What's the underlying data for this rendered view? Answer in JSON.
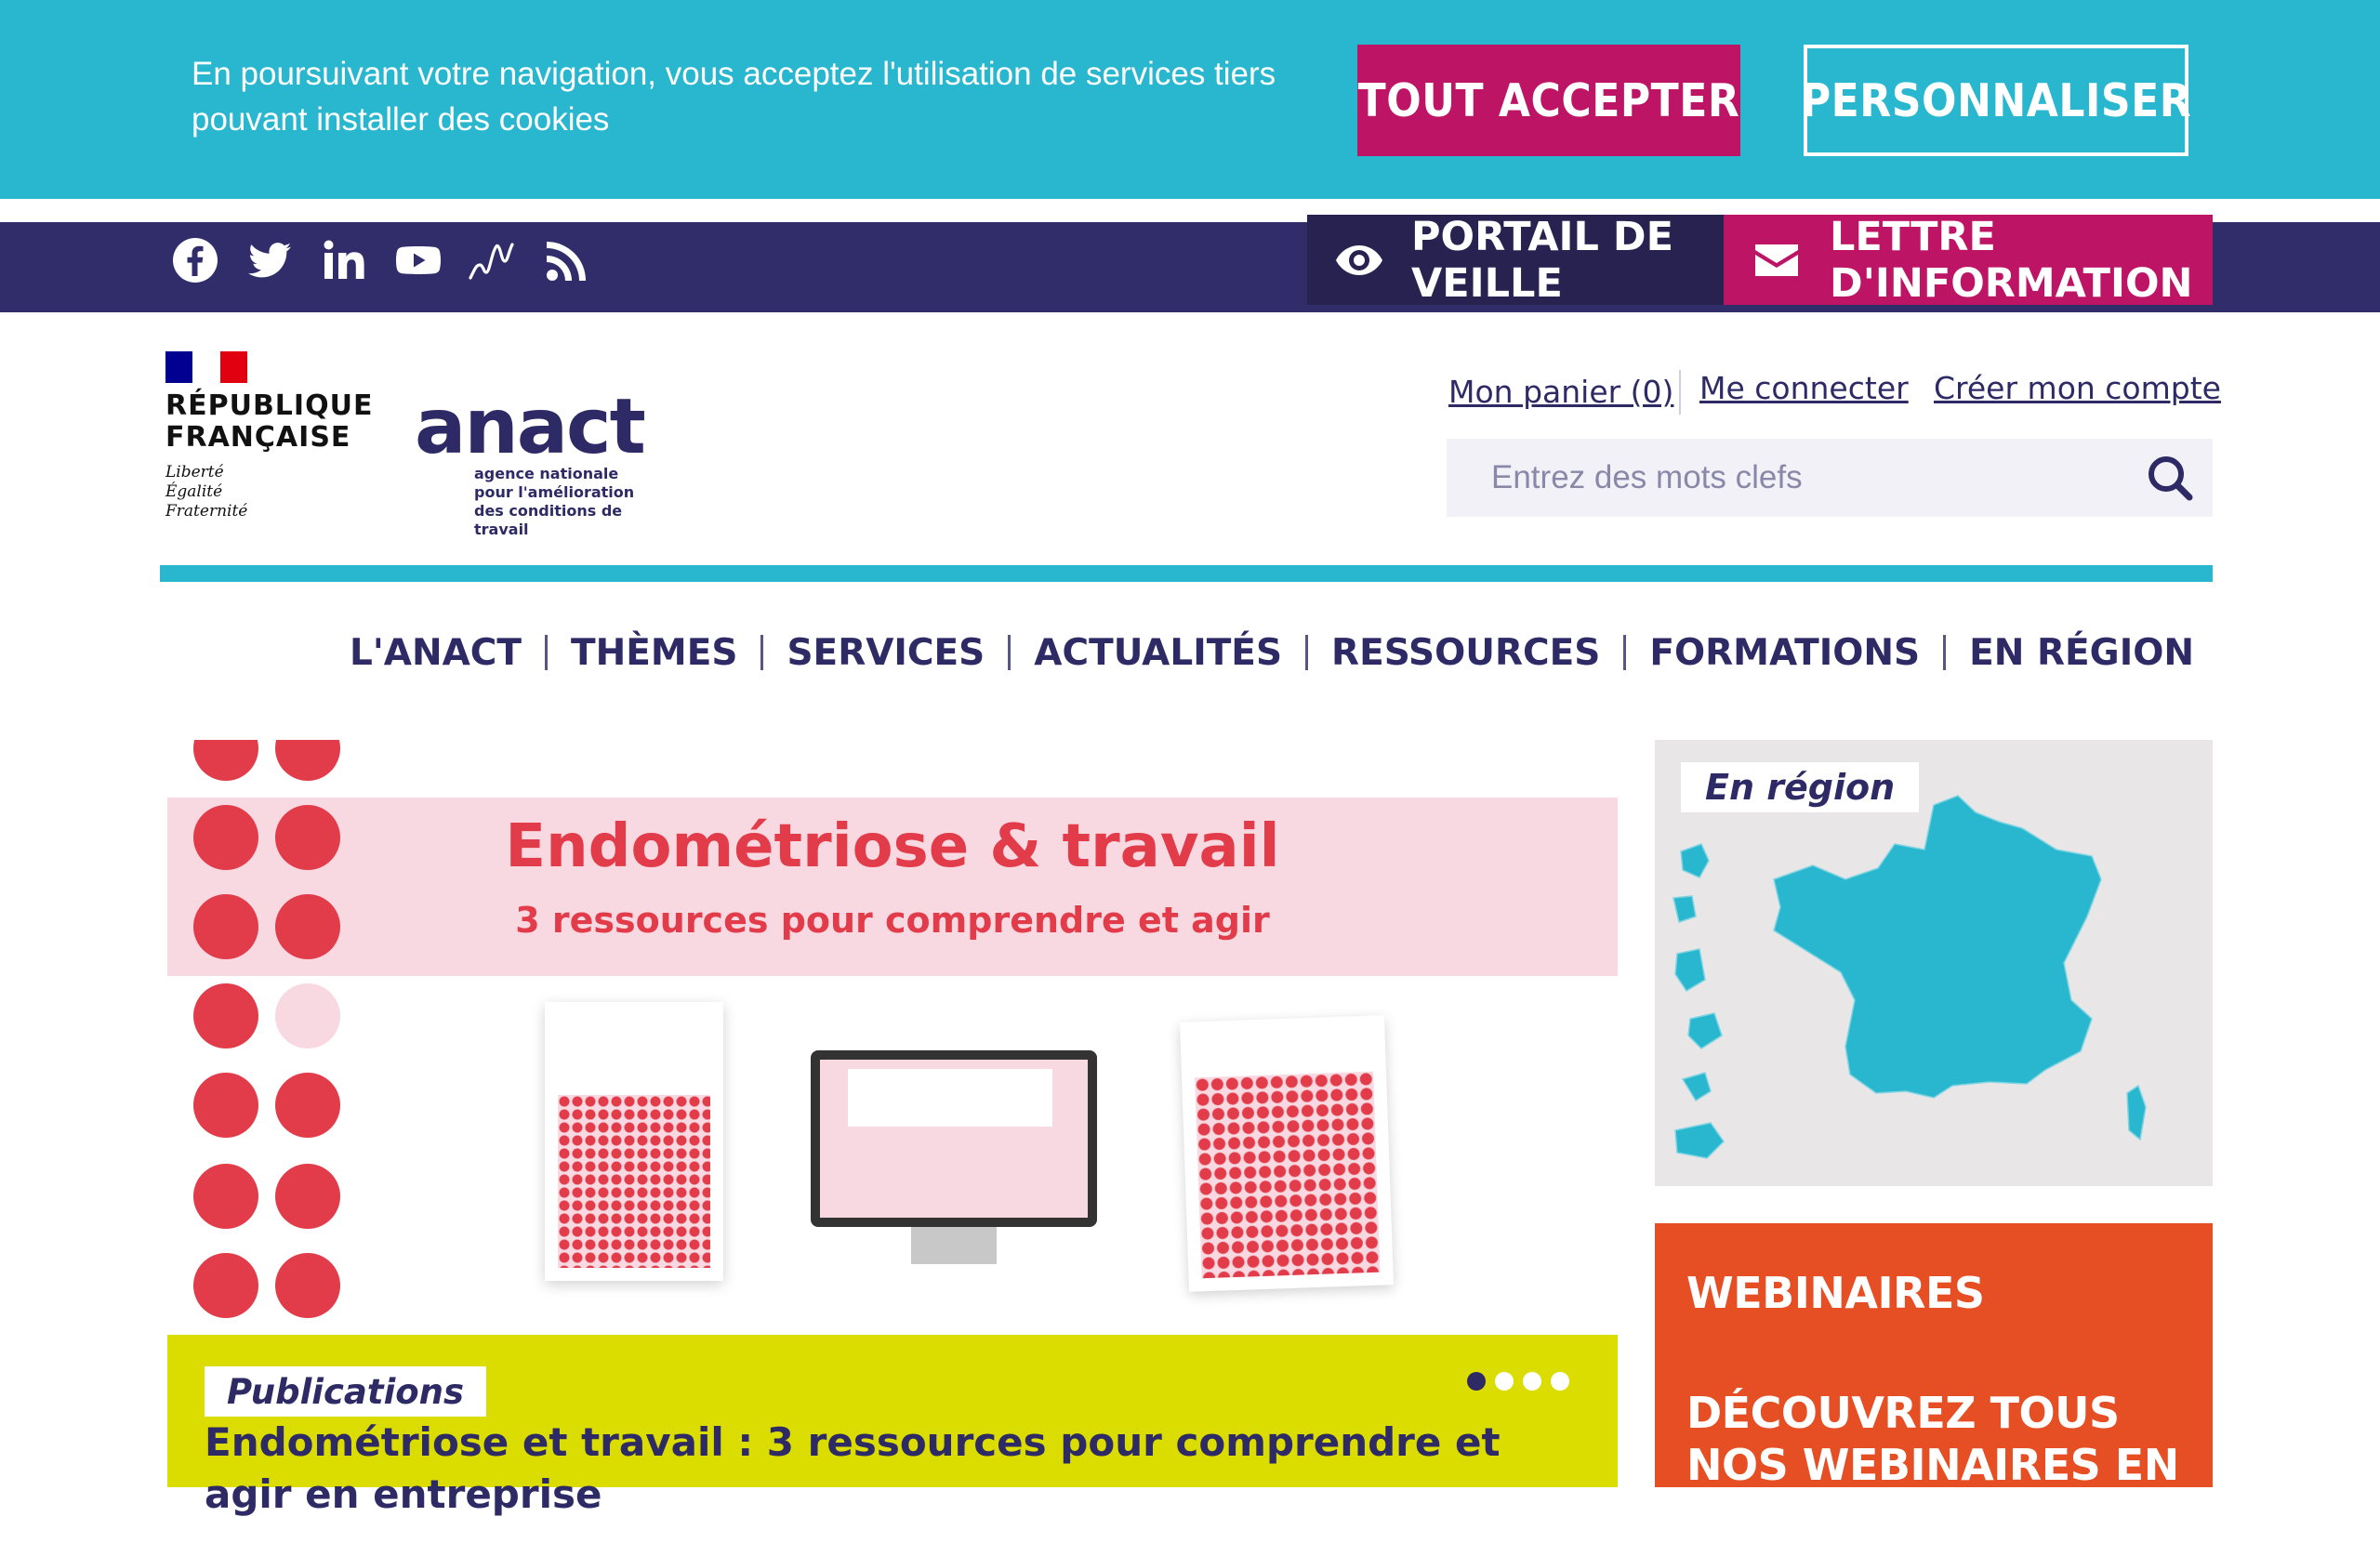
{
  "cookie_banner": {
    "text": "En poursuivant votre navigation, vous acceptez l'utilisation de services tiers pouvant installer des cookies",
    "accept_label": "TOUT ACCEPTER",
    "customize_label": "PERSONNALISER"
  },
  "topbar": {
    "social_icons": [
      "facebook-icon",
      "twitter-icon",
      "linkedin-icon",
      "youtube-icon",
      "sparkline-icon",
      "rss-icon"
    ],
    "portail_label": "PORTAIL DE VEILLE",
    "lettre_label": "LETTRE D'INFORMATION"
  },
  "header": {
    "rf_title_line1": "RÉPUBLIQUE",
    "rf_title_line2": "FRANÇAISE",
    "rf_motto_1": "Liberté",
    "rf_motto_2": "Égalité",
    "rf_motto_3": "Fraternité",
    "anact_wordmark": "anact",
    "anact_sub_1": "agence nationale",
    "anact_sub_2": "pour l'amélioration",
    "anact_sub_3": "des conditions de travail",
    "cart_label": "Mon panier (0)",
    "login_label": "Me connecter",
    "register_label": "Créer mon compte",
    "search_placeholder": "Entrez des mots clefs"
  },
  "nav": {
    "items": [
      "L'ANACT",
      "THÈMES",
      "SERVICES",
      "ACTUALITÉS",
      "RESSOURCES",
      "FORMATIONS",
      "EN RÉGION"
    ]
  },
  "hero": {
    "title": "Endométriose & travail",
    "subtitle": "3 ressources pour comprendre et agir",
    "category": "Publications",
    "headline": "Endométriose et travail : 3 ressources pour comprendre et agir en entreprise",
    "slides_total": 4,
    "active_slide": 1
  },
  "region_card": {
    "tag": "En région"
  },
  "webinar_card": {
    "title": "WEBINAIRES",
    "text": "DÉCOUVREZ TOUS NOS WEBINAIRES EN REPLAY"
  },
  "colors": {
    "cookie_bg": "#28b7cf",
    "brand_navy": "#312d6b",
    "magenta": "#bd1466",
    "hero_red": "#e23c4a",
    "caption_yellow": "#dbdc00",
    "webinar_orange": "#e64e24"
  }
}
